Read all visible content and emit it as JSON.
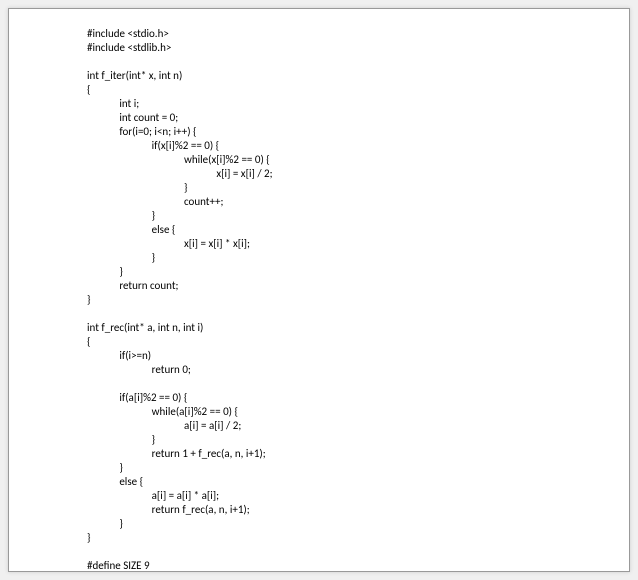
{
  "lines": [
    "#include <stdio.h>",
    "#include <stdlib.h>",
    "",
    "int f_iter(int* x, int n)",
    "{",
    "             int i;",
    "             int count = 0;",
    "             for(i=0; i<n; i++) {",
    "                          if(x[i]%2 == 0) {",
    "                                       while(x[i]%2 == 0) {",
    "                                                    x[i] = x[i] / 2;",
    "                                       }",
    "                                       count++;",
    "                          }",
    "                          else {",
    "                                       x[i] = x[i] * x[i];",
    "                          }",
    "             }",
    "             return count;",
    "}",
    "",
    "int f_rec(int* a, int n, int i)",
    "{",
    "             if(i>=n)",
    "                          return 0;",
    "",
    "             if(a[i]%2 == 0) {",
    "                          while(a[i]%2 == 0) {",
    "                                       a[i] = a[i] / 2;",
    "                          }",
    "                          return 1 + f_rec(a, n, i+1);",
    "             }",
    "             else {",
    "                          a[i] = a[i] * a[i];",
    "                          return f_rec(a, n, i+1);",
    "             }",
    "}",
    "",
    "#define SIZE 9"
  ]
}
